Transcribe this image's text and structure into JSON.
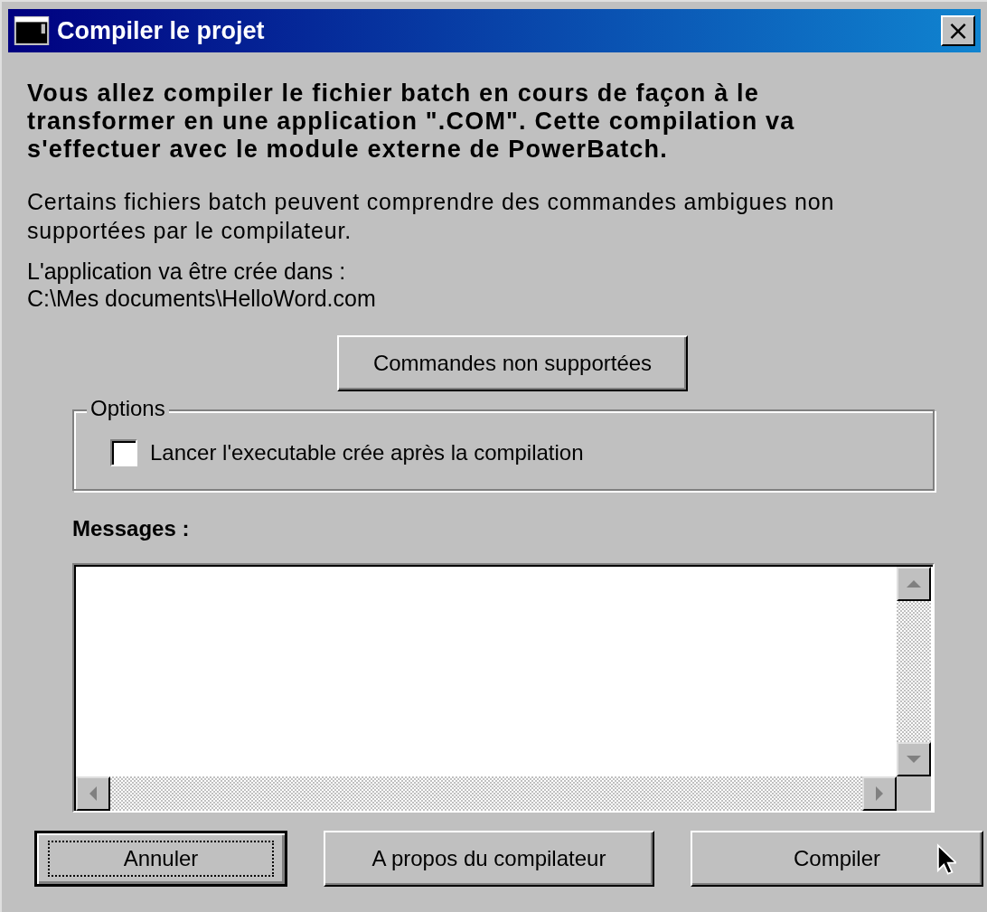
{
  "window": {
    "title": "Compiler le projet",
    "close_label": "×"
  },
  "intro": "Vous allez compiler le fichier batch en cours de façon à le transformer en une application \".COM\". Cette compilation va s'effectuer avec le module externe de PowerBatch.",
  "warning": "Certains fichiers batch peuvent comprendre des commandes ambigues non supportées par le compilateur.",
  "output_label": "L'application va être crée dans :",
  "output_path": "C:\\Mes documents\\HelloWord.com",
  "unsupported_button": "Commandes non supportées",
  "options": {
    "legend": "Options",
    "items": [
      {
        "label": "Lancer l'executable crée après la compilation",
        "checked": false
      }
    ]
  },
  "messages": {
    "label": "Messages :"
  },
  "buttons": [
    {
      "label": "Annuler",
      "default": true
    },
    {
      "label": "A propos du compilateur",
      "default": false
    },
    {
      "label": "Compiler",
      "default": false
    }
  ]
}
